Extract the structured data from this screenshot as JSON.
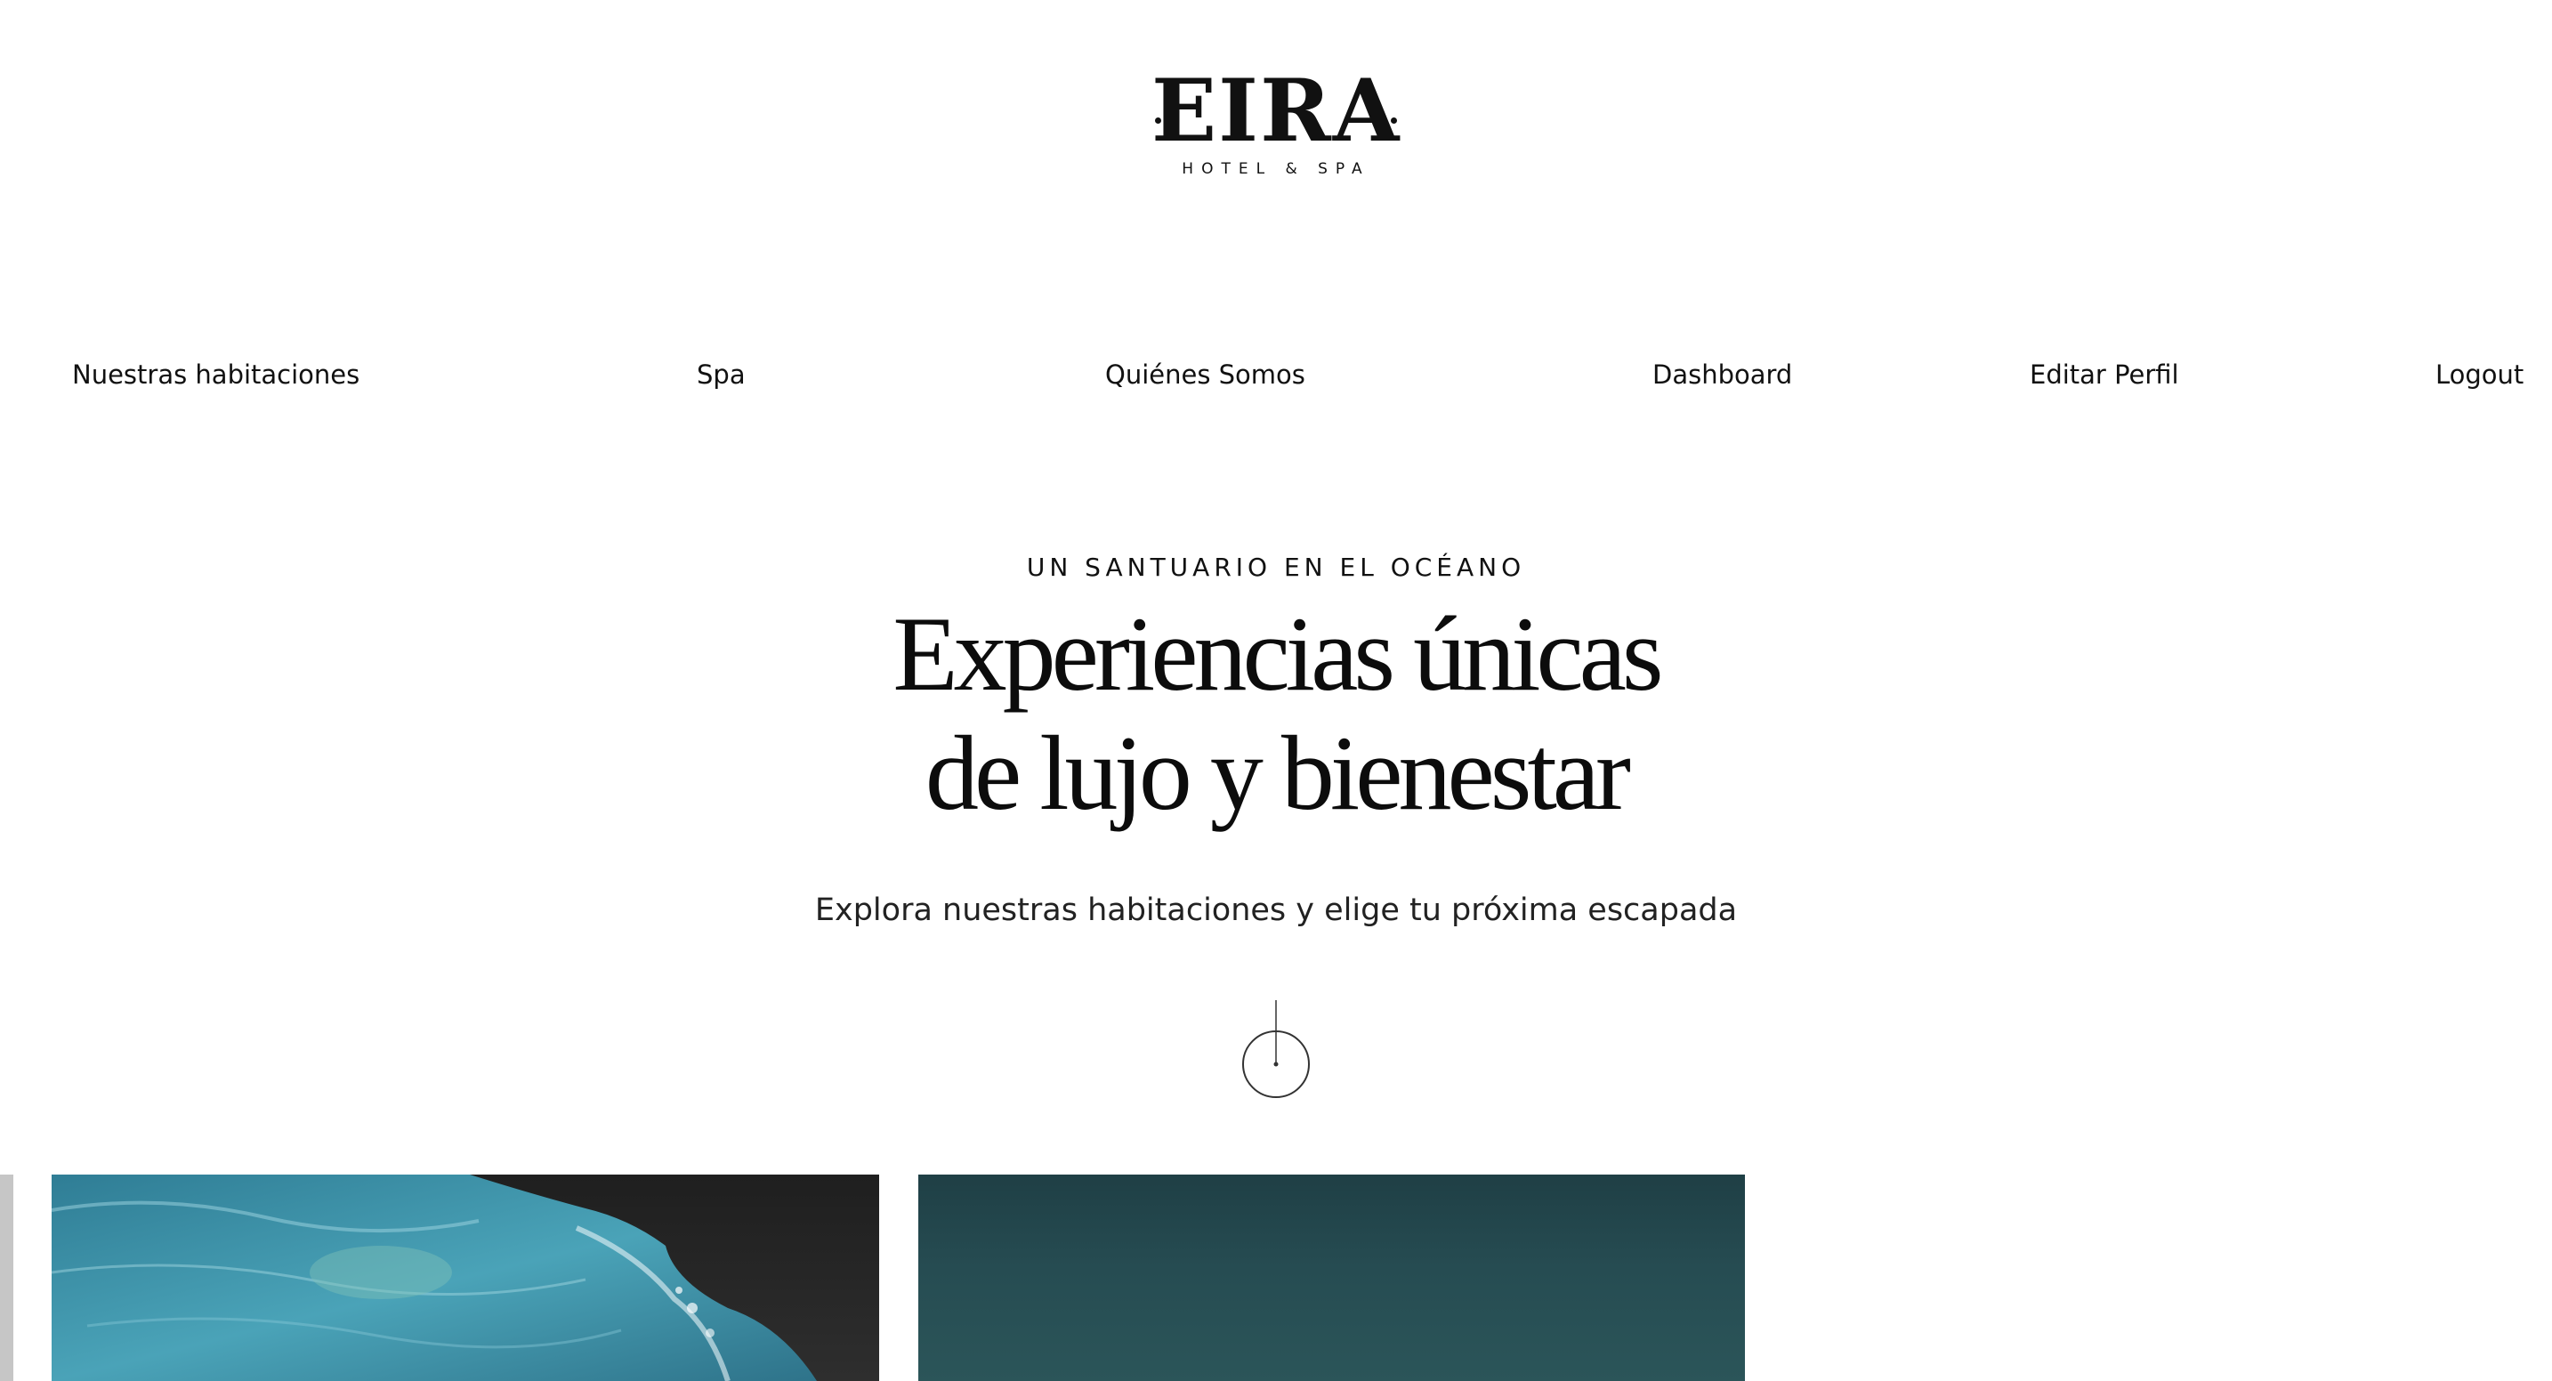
{
  "brand": {
    "logo_text": "EIRA",
    "logo_subtitle": "HOTEL & SPA"
  },
  "nav": {
    "items": [
      {
        "label": "Nuestras habitaciones"
      },
      {
        "label": "Spa"
      },
      {
        "label": "Quiénes Somos"
      },
      {
        "label": "Dashboard"
      },
      {
        "label": "Editar Perfil"
      },
      {
        "label": "Logout"
      }
    ]
  },
  "hero": {
    "eyebrow": "UN SANTUARIO EN EL OCÉANO",
    "title_line1": "Experiencias únicas",
    "title_line2": "de lujo y bienestar",
    "subtitle": "Explora nuestras habitaciones y elige tu próxima escapada"
  },
  "icons": {
    "scroll": "scroll-down-icon"
  },
  "colors": {
    "background": "#ffffff",
    "text": "#111111",
    "ocean": "#3f8fa8",
    "teal": "#244a50"
  }
}
